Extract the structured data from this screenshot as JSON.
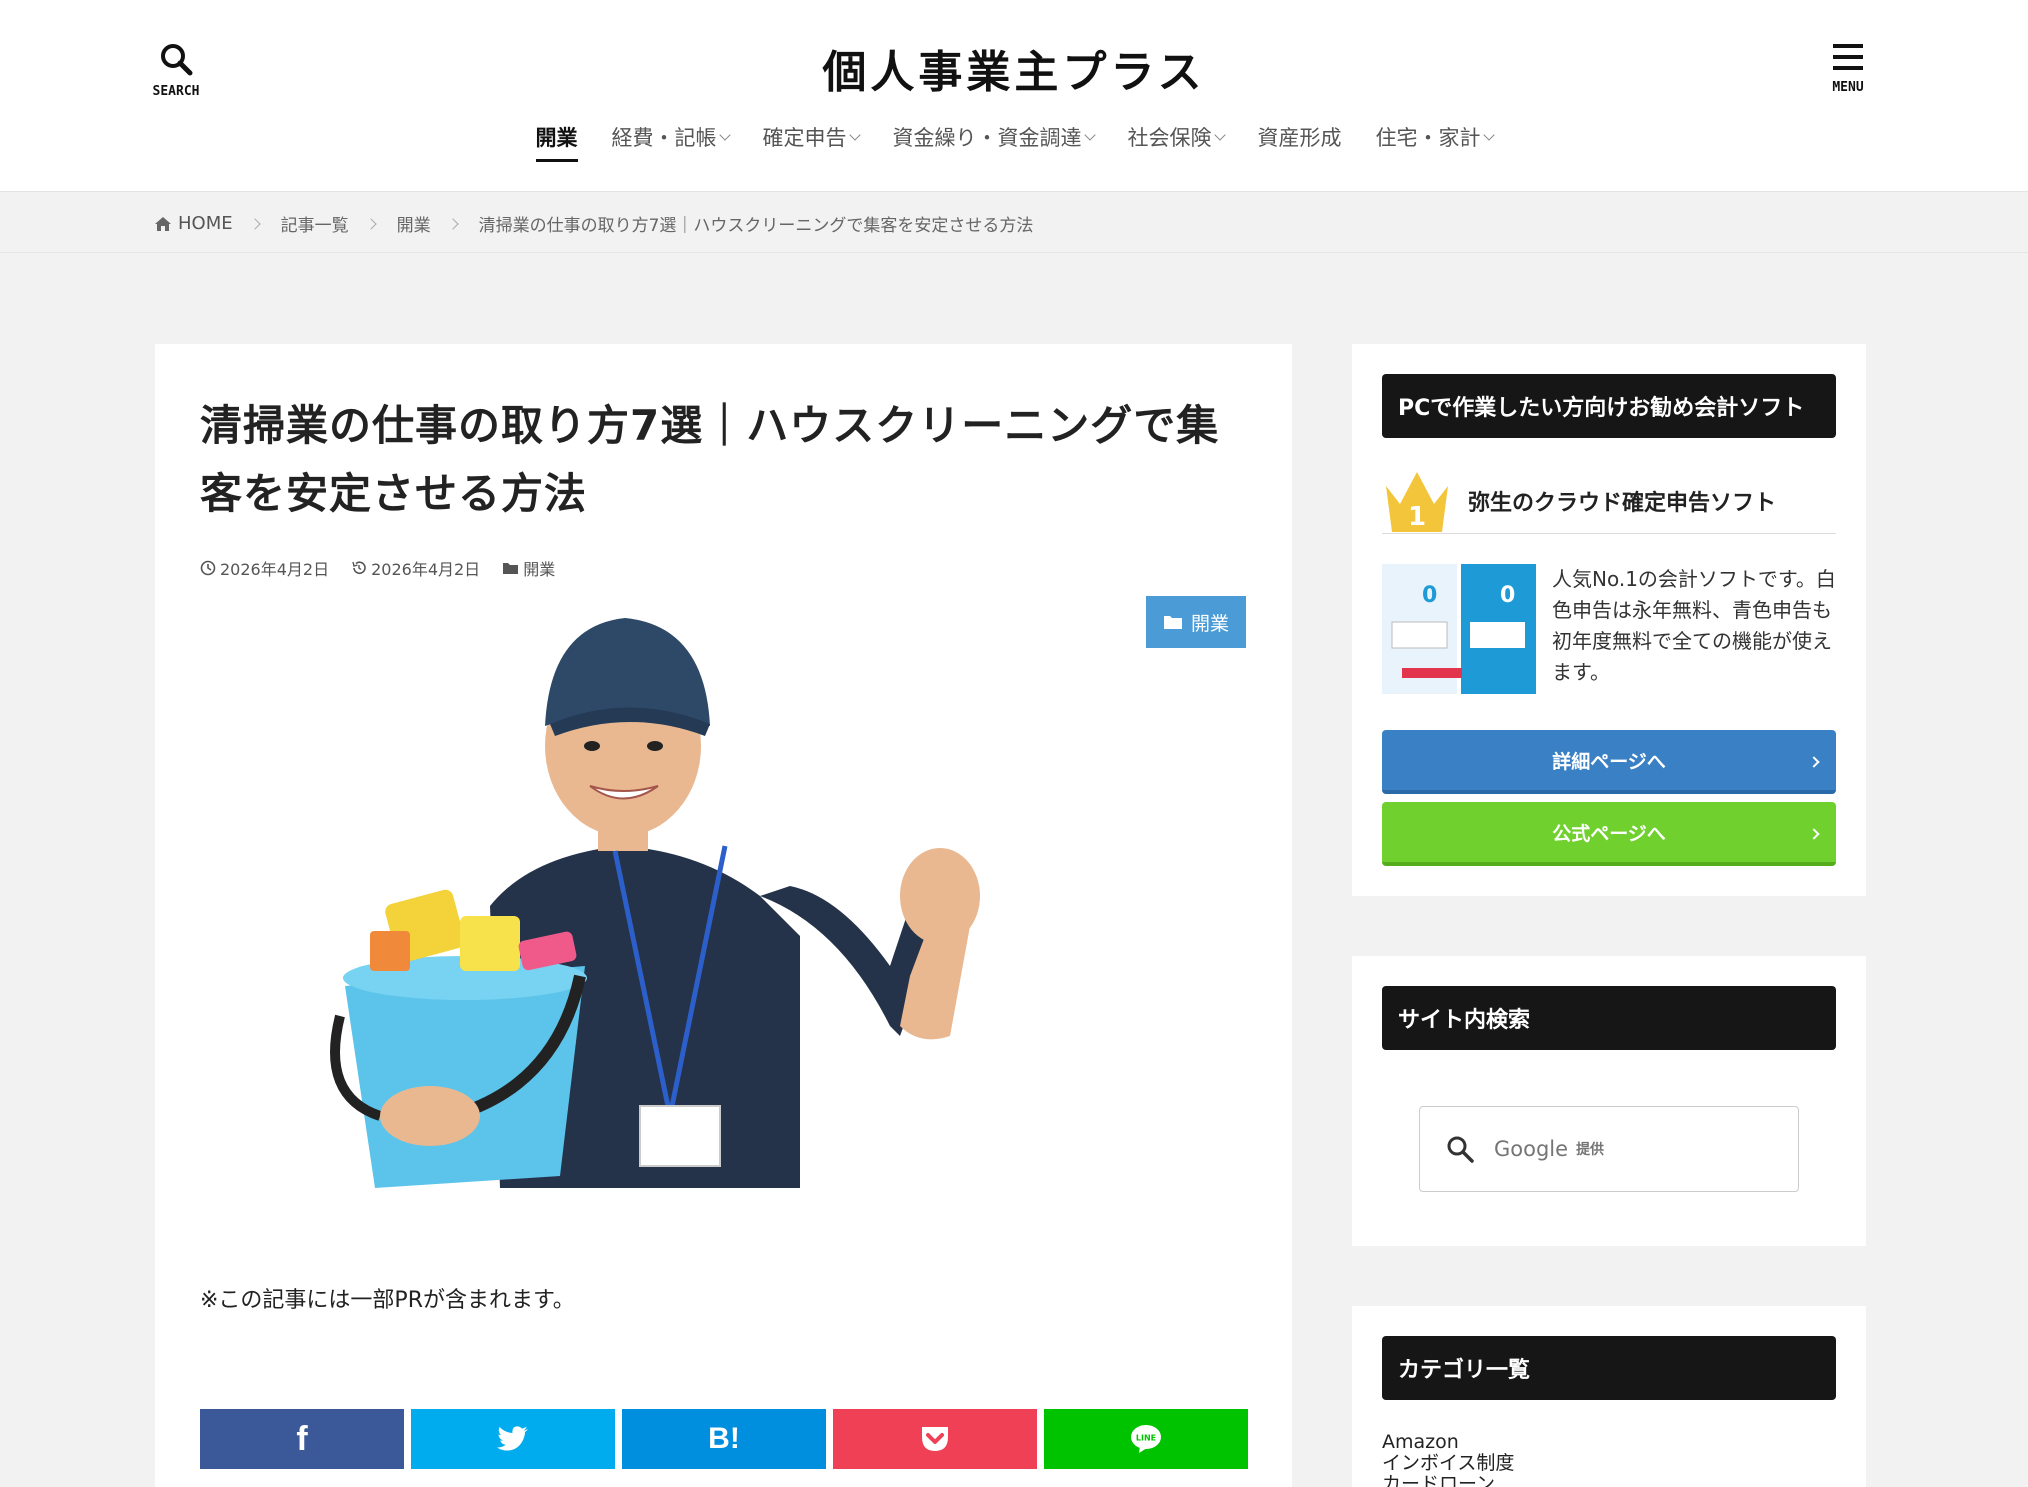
{
  "header": {
    "site_title": "個人事業主プラス",
    "search_label": "SEARCH",
    "menu_label": "MENU",
    "nav": [
      {
        "label": "開業",
        "active": true,
        "dropdown": false
      },
      {
        "label": "経費・記帳",
        "active": false,
        "dropdown": true
      },
      {
        "label": "確定申告",
        "active": false,
        "dropdown": true
      },
      {
        "label": "資金繰り・資金調達",
        "active": false,
        "dropdown": true
      },
      {
        "label": "社会保険",
        "active": false,
        "dropdown": true
      },
      {
        "label": "資産形成",
        "active": false,
        "dropdown": false
      },
      {
        "label": "住宅・家計",
        "active": false,
        "dropdown": true
      }
    ]
  },
  "breadcrumb": {
    "home": "HOME",
    "items": [
      "記事一覧",
      "開業",
      "清掃業の仕事の取り方7選｜ハウスクリーニングで集客を安定させる方法"
    ]
  },
  "article": {
    "title": "清掃業の仕事の取り方7選｜ハウスクリーニングで集客を安定させる方法",
    "published": "2026年4月2日",
    "updated": "2026年4月2日",
    "category": "開業",
    "badge": "開業",
    "pr_note": "※この記事には一部PRが含まれます。",
    "share": [
      {
        "name": "facebook",
        "label": "f",
        "color": "#3b5998"
      },
      {
        "name": "twitter",
        "label": "",
        "color": "#00aced"
      },
      {
        "name": "hatena",
        "label": "B!",
        "color": "#008fde"
      },
      {
        "name": "pocket",
        "label": "",
        "color": "#ef4056"
      },
      {
        "name": "line",
        "label": "",
        "color": "#00c300"
      }
    ]
  },
  "sidebar": {
    "software": {
      "heading": "PCで作業したい方向けお勧め会計ソフト",
      "rank": "1",
      "name": "弥生のクラウド確定申告ソフト",
      "description": "人気No.1の会計ソフトです。白色申告は永年無料、青色申告も初年度無料で全ての機能が使えます。",
      "detail_button": "詳細ページへ",
      "official_button": "公式ページへ",
      "detail_color": "#3a80c4",
      "official_color": "#6fd02e"
    },
    "search": {
      "heading": "サイト内検索",
      "placeholder": "Google",
      "provider": "提供"
    },
    "categories": {
      "heading": "カテゴリ一覧",
      "items": [
        "Amazon",
        "インボイス制度",
        "カードローン"
      ]
    }
  }
}
